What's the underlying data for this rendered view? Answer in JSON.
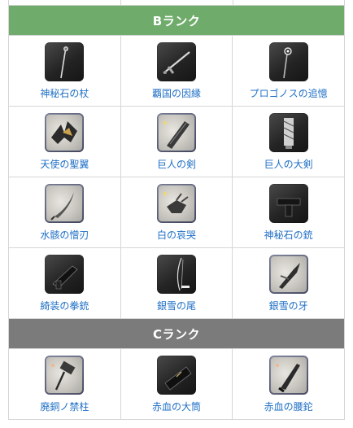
{
  "ranks": [
    {
      "title": "Bランク",
      "color": "#6fab6a",
      "rows": [
        [
          {
            "name": "神秘石の杖",
            "icon": "staff-icon",
            "style": "dark"
          },
          {
            "name": "覇国の因縁",
            "icon": "sword-icon",
            "style": "dark"
          },
          {
            "name": "プロゴノスの追憶",
            "icon": "scepter-icon",
            "style": "dark"
          }
        ],
        [
          {
            "name": "天使の聖翼",
            "icon": "wings-icon",
            "style": "light"
          },
          {
            "name": "巨人の剣",
            "icon": "greatsword-icon",
            "style": "light"
          },
          {
            "name": "巨人の大剣",
            "icon": "banner-sword-icon",
            "style": "dark"
          }
        ],
        [
          {
            "name": "水骸の憎刃",
            "icon": "curved-blade-icon",
            "style": "light"
          },
          {
            "name": "白の哀哭",
            "icon": "claw-icon",
            "style": "light"
          },
          {
            "name": "神秘石の銃",
            "icon": "gun-icon",
            "style": "dark"
          }
        ],
        [
          {
            "name": "綺装の拳銃",
            "icon": "pistol-icon",
            "style": "dark"
          },
          {
            "name": "銀雪の尾",
            "icon": "bow-icon",
            "style": "dark"
          },
          {
            "name": "銀雪の牙",
            "icon": "fang-blade-icon",
            "style": "light"
          }
        ]
      ]
    },
    {
      "title": "Cランク",
      "color": "#7b7b7b",
      "rows": [
        [
          {
            "name": "廃銅ノ禁柱",
            "icon": "hammer-icon",
            "style": "light"
          },
          {
            "name": "赤血の大筒",
            "icon": "cannon-icon",
            "style": "dark"
          },
          {
            "name": "赤血の腰鉈",
            "icon": "machete-icon",
            "style": "light"
          }
        ]
      ]
    }
  ]
}
